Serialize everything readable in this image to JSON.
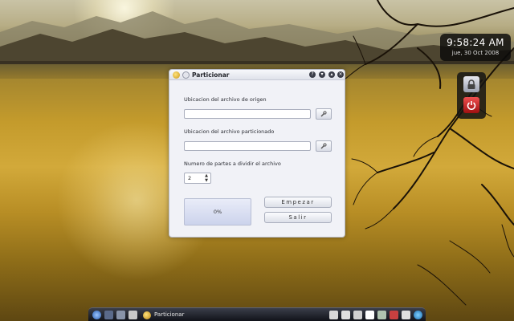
{
  "clock": {
    "time": "9:58:24 AM",
    "date": "jue, 30 Oct 2008"
  },
  "window": {
    "title": "Particionar"
  },
  "form": {
    "origin_label": "Ubicacion del archivo de origen",
    "origin_value": "",
    "split_label": "Ubicacion del archivo particionado",
    "split_value": "",
    "parts_label": "Numero de partes a dividir el archivo",
    "parts_value": "2",
    "progress": "0%",
    "start_label": "Empezar",
    "exit_label": "Salir"
  },
  "taskbar": {
    "task_label": "Particionar"
  },
  "colors": {
    "accent": "#c8951a",
    "power": "#d42020",
    "taskbar": "#1a1c22"
  }
}
